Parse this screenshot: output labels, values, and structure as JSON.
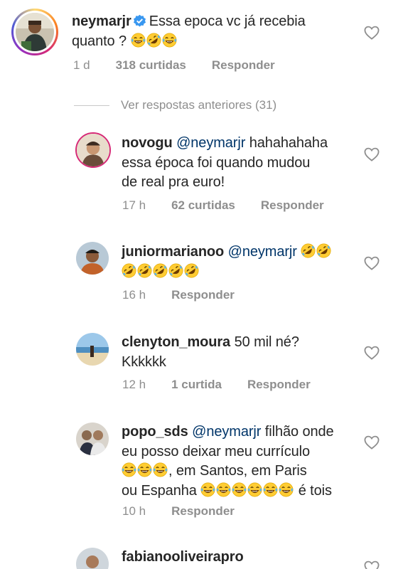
{
  "main_comment": {
    "username": "neymarjr",
    "text_line1": "Essa epoca vc já recebia",
    "text_line2": "quanto ?",
    "time": "1 d",
    "likes": "318 curtidas",
    "reply": "Responder"
  },
  "view_previous": "Ver respostas anteriores (31)",
  "replies": [
    {
      "username": "novogu",
      "mention": "@neymarjr",
      "text_a": "hahahahaha",
      "text_b": "essa época foi quando mudou",
      "text_c": "de real pra euro!",
      "time": "17 h",
      "likes": "62 curtidas",
      "reply": "Responder"
    },
    {
      "username": "juniormarianoo",
      "mention": "@neymarjr",
      "time": "16 h",
      "reply": "Responder"
    },
    {
      "username": "clenyton_moura",
      "text_a": "50 mil né?",
      "text_b": "Kkkkkk",
      "time": "12 h",
      "likes": "1 curtida",
      "reply": "Responder"
    },
    {
      "username": "popo_sds",
      "mention": "@neymarjr",
      "text_a": "filhão onde",
      "text_b": "eu posso deixar meu currículo",
      "text_c": ", em Santos, em Paris",
      "text_d": "ou Espanha",
      "text_e": "é tois",
      "time": "10 h",
      "reply": "Responder"
    },
    {
      "username": "fabianooliveirapro"
    }
  ],
  "icons": {
    "heart": "heart-outline-icon",
    "verified": "verified-badge-icon",
    "emoji_joy": "face-with-tears-of-joy-icon",
    "emoji_rofl": "rolling-on-floor-laughing-icon"
  },
  "colors": {
    "text": "#262626",
    "muted": "#8e8e8e",
    "mention": "#003569",
    "verified": "#3897f0",
    "emoji": "#ffcc33"
  }
}
